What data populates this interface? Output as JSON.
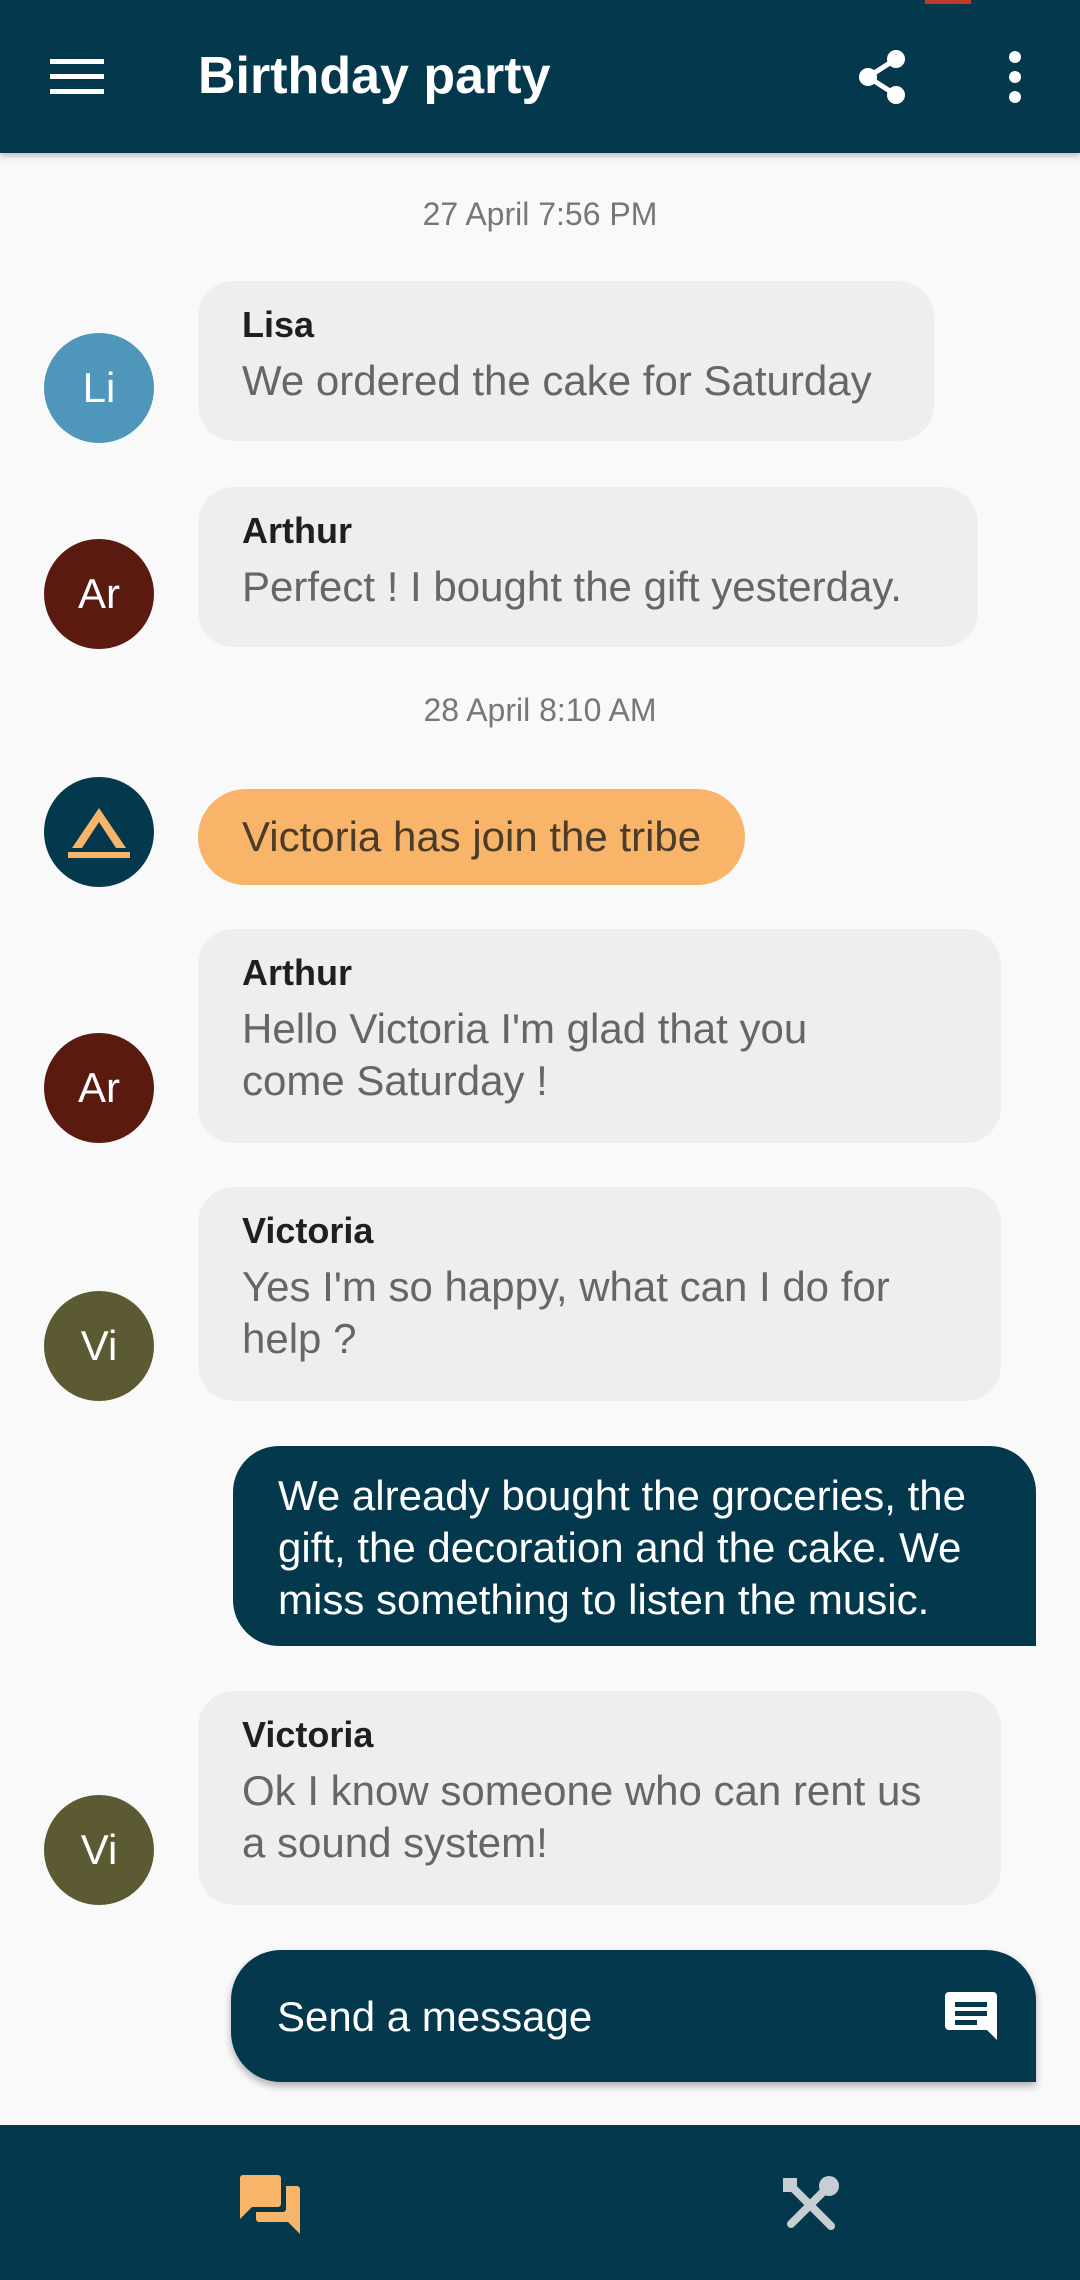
{
  "app_bar": {
    "title": "Birthday party",
    "icons": {
      "menu": "hamburger-menu-icon",
      "share": "share-icon",
      "more": "more-vertical-icon"
    }
  },
  "messages": [
    {
      "type": "timestamp",
      "text": "27 April 7:56 PM"
    },
    {
      "type": "received",
      "avatar": "Li",
      "avatar_color": "#4f96bb",
      "author": "Lisa",
      "text": "We ordered the cake for Saturday"
    },
    {
      "type": "received",
      "avatar": "Ar",
      "avatar_color": "#5a1a10",
      "author": "Arthur",
      "text": "Perfect ! I bought the gift yesterday."
    },
    {
      "type": "timestamp",
      "text": "28 April 8:10 AM"
    },
    {
      "type": "event",
      "avatar_icon": "tribe-logo-icon",
      "text": "Victoria has join the tribe"
    },
    {
      "type": "received",
      "avatar": "Ar",
      "avatar_color": "#5a1a10",
      "author": "Arthur",
      "text_lines": [
        "Hello Victoria I'm glad that you",
        "come Saturday !"
      ]
    },
    {
      "type": "received",
      "avatar": "Vi",
      "avatar_color": "#5c5a33",
      "author": "Victoria",
      "text_lines": [
        "Yes I'm so happy, what can I do for",
        "help ?"
      ]
    },
    {
      "type": "sent",
      "text_lines": [
        "We already bought the groceries, the",
        "gift, the decoration and the cake. We",
        "miss something to listen the music."
      ]
    },
    {
      "type": "received",
      "avatar": "Vi",
      "avatar_color": "#5c5a33",
      "author": "Victoria",
      "text_lines": [
        "Ok I know someone who can rent us",
        "a sound system!"
      ]
    }
  ],
  "composer": {
    "placeholder": "Send a message",
    "send_icon": "send-message-icon"
  },
  "bottom_nav": {
    "items": [
      {
        "icon": "chat-icon",
        "active": true
      },
      {
        "icon": "tools-icon",
        "active": false
      }
    ]
  },
  "colors": {
    "primary": "#04384d",
    "accent": "#f8b469",
    "bubble": "#eceeef",
    "background": "#f9f9f9"
  }
}
